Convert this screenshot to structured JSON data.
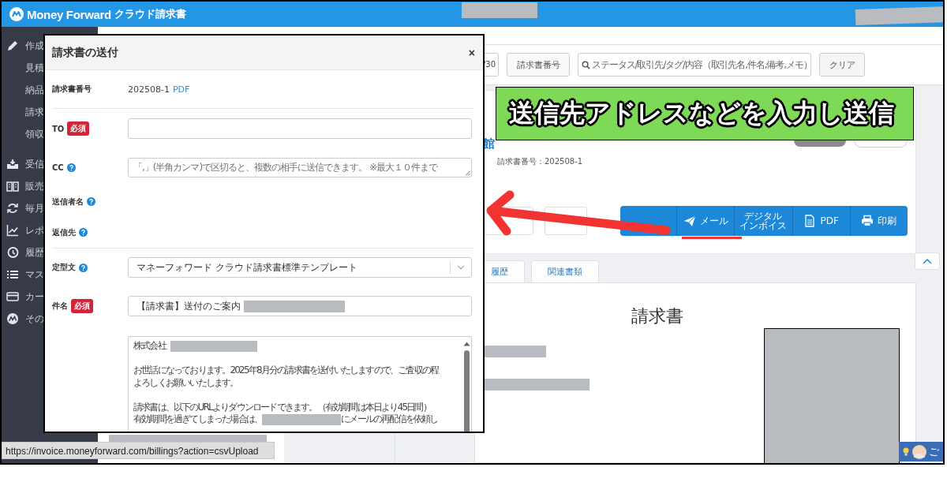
{
  "app": {
    "brand": "Money Forward",
    "product": "クラウド請求書"
  },
  "sidebar": {
    "items": [
      {
        "label": "作成",
        "children": [
          {
            "label": "見積"
          },
          {
            "label": "納品"
          },
          {
            "label": "請求"
          },
          {
            "label": "領収"
          }
        ]
      },
      {
        "label": "受信"
      },
      {
        "label": "販売"
      },
      {
        "label": "毎月"
      },
      {
        "label": "レポ"
      },
      {
        "label": "履歴"
      },
      {
        "label": "マス"
      },
      {
        "label": "カー"
      },
      {
        "label": "その"
      }
    ]
  },
  "toolbar": {
    "page_field": "/30",
    "number_button": "請求書番号",
    "search": {
      "placeholder": "ステータス/取引先/タグ/内容（取引先名,件名,備考,メモ）"
    },
    "clear_button": "クリア"
  },
  "invoice": {
    "title": "館",
    "number_line": "請求書番号：202508-1",
    "actions": [
      {
        "kind": "mail",
        "lines": [
          "メール"
        ]
      },
      {
        "kind": "digital",
        "lines": [
          "デジタル",
          "インボイス"
        ]
      },
      {
        "kind": "pdf",
        "lines": [
          "PDF"
        ]
      },
      {
        "kind": "print",
        "lines": [
          "印刷"
        ]
      }
    ]
  },
  "tabs": [
    {
      "label": "履歴",
      "selected": false
    },
    {
      "label": "関連書類",
      "selected": false
    }
  ],
  "preview": {
    "heading": "請求書"
  },
  "modal": {
    "title": "請求書の送付",
    "close": "×",
    "sections": [
      [
        {
          "kind": "info",
          "label": "請求書番号",
          "value": "202508-1",
          "link": "PDF"
        }
      ],
      [
        {
          "kind": "input",
          "label": "TO",
          "badge": "必須"
        },
        {
          "kind": "textarea",
          "label": "CC",
          "help": true,
          "placeholder": "「,」(半角カンマ)で区切ると、複数の相手に送信できます。 ※最大１０件まで"
        },
        {
          "kind": "plain",
          "label": "送信者名",
          "help": true
        },
        {
          "kind": "plain",
          "label": "返信先",
          "help": true
        }
      ],
      [
        {
          "kind": "select",
          "label": "定型文",
          "help": true,
          "value": "マネーフォワード クラウド請求書標準テンプレート"
        },
        {
          "kind": "input",
          "label": "件名",
          "badge": "必須",
          "value": "【請求書】送付のご案内",
          "redacted": true
        },
        {
          "kind": "message",
          "lines": [
            [
              {
                "kind": "text",
                "text": "株式会社"
              },
              {
                "kind": "redacted"
              }
            ],
            [
              {
                "kind": "blank"
              }
            ],
            [
              {
                "kind": "text",
                "text": "お世話になっております。2025年8月分の請求書を送付いたしますので、ご査収の程"
              }
            ],
            [
              {
                "kind": "text",
                "text": "よろしくお願いいたします。"
              }
            ],
            [
              {
                "kind": "blank"
              }
            ],
            [
              {
                "kind": "text",
                "text": "請求書は、以下のURLよりダウンロードできます。（有効期間は本日より45日間）"
              }
            ],
            [
              {
                "kind": "text",
                "text": "有効期間を過ぎてしまった場合は、"
              },
              {
                "kind": "redacted"
              },
              {
                "kind": "text",
                "text": "にメールの再配信を依頼し"
              }
            ]
          ]
        }
      ]
    ]
  },
  "status_url": "https://invoice.moneyforward.com/billings?action=csvUpload",
  "help_widget": {
    "text": "ご"
  },
  "annotation": {
    "text": "送信先アドレスなどを入力し送信"
  }
}
